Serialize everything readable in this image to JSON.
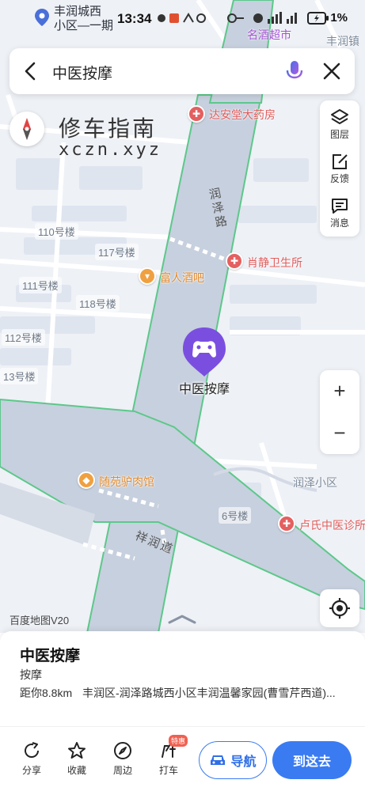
{
  "status_bar": {
    "location_line1": "丰润城西",
    "location_line2": "小区—一期",
    "time": "13:34",
    "battery": "1%"
  },
  "search": {
    "query": "中医按摩"
  },
  "map": {
    "watermark_cn": "修车指南",
    "watermark_en": "xczn.xyz",
    "logo": "百度地图V20",
    "pois": {
      "pharmacy": "达安堂大药房",
      "clinic_xiao": "肖静卫生所",
      "bar": "富人酒吧",
      "restaurant": "随苑驴肉馆",
      "clinic_lu": "卢氏中医诊所",
      "supermarket": "名酒超市",
      "community": "润泽小区",
      "town": "丰润镇"
    },
    "buildings": [
      "110号楼",
      "117号楼",
      "111号楼",
      "118号楼",
      "112号楼",
      "13号楼",
      "6号楼"
    ],
    "streets": {
      "runze_road": "润泽路",
      "xiangrun_road": "祥润道"
    },
    "marker_label": "中医按摩"
  },
  "tools": {
    "layers": "图层",
    "feedback": "反馈",
    "messages": "消息"
  },
  "zoom": {
    "in": "+",
    "out": "−"
  },
  "card": {
    "name": "中医按摩",
    "category": "按摩",
    "distance": "距你8.8km",
    "address": "丰润区-润泽路城西小区丰润温馨家园(曹雪芹西道)..."
  },
  "actions": {
    "share": "分享",
    "favorite": "收藏",
    "nearby": "周边",
    "taxi": "打车",
    "taxi_badge": "特惠",
    "navigate": "导航",
    "go_here": "到这去"
  },
  "colors": {
    "accent": "#3a7bf2",
    "marker": "#7a4fe0",
    "road_border": "#5cc88a"
  }
}
